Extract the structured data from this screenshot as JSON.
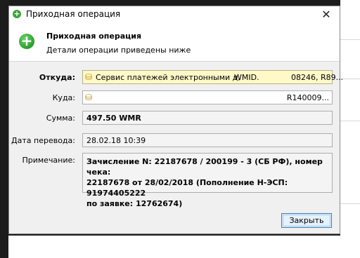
{
  "window": {
    "title": "Приходная операция"
  },
  "header": {
    "title": "Приходная операция",
    "subtitle": "Детали операции приведены ниже"
  },
  "fields": {
    "from": {
      "label": "Откуда:",
      "name": "Сервис платежей электронными д,",
      "wmid": "WMID.",
      "purse": "08246, R89..."
    },
    "to": {
      "label": "Куда:",
      "purse": "R140009..."
    },
    "amount": {
      "label": "Сумма:",
      "value": "497.50 WMR"
    },
    "date": {
      "label": "Дата перевода:",
      "value": "28.02.18 10:39"
    },
    "note": {
      "label": "Примечание:",
      "value": "Зачисление N: 22187678 / 200199 - 3 (СБ РФ), номер чека:\n22187678 от 28/02/2018 (Пополнение Н-ЭСП: 91974405222\nпо заявке: 12762674)"
    }
  },
  "buttons": {
    "close": "Закрыть"
  },
  "icons": {
    "title": "plus-circle-icon",
    "header": "plus-circle-icon",
    "from": "wallet-icon",
    "to": "wallet-icon",
    "close": "close-icon"
  },
  "colors": {
    "accent_green": "#34a534",
    "from_field_bg": "#fff9c8",
    "button_border": "#3c7fb1"
  }
}
